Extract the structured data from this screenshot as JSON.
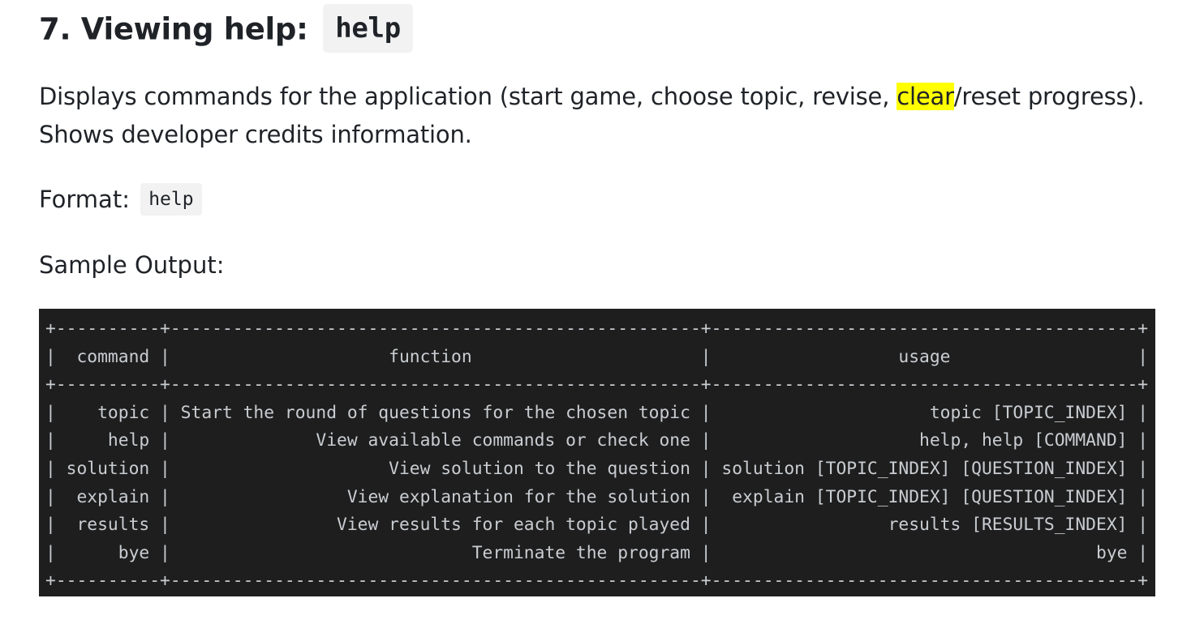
{
  "section": {
    "title_text": "7. Viewing help:",
    "title_code": "help",
    "description_before_highlight": "Displays commands for the application (start game, choose topic, revise, ",
    "description_highlight": "clear",
    "description_after_highlight": "/reset progress). Shows developer credits information.",
    "highlight_color": "#ffff00",
    "format_label": "Format:",
    "format_code": "help",
    "sample_output_label": "Sample Output:"
  },
  "terminal": {
    "background": "#1e1e1e",
    "headers": [
      "command",
      "function",
      "usage"
    ],
    "rows": [
      {
        "command": "topic",
        "function": "Start the round of questions for the chosen topic",
        "usage": "topic [TOPIC_INDEX]"
      },
      {
        "command": "help",
        "function": "View available commands or check one",
        "usage": "help, help [COMMAND]"
      },
      {
        "command": "solution",
        "function": "View solution to the question",
        "usage": "solution [TOPIC_INDEX] [QUESTION_INDEX]"
      },
      {
        "command": "explain",
        "function": "View explanation for the solution",
        "usage": "explain [TOPIC_INDEX] [QUESTION_INDEX]"
      },
      {
        "command": "results",
        "function": "View results for each topic played",
        "usage": "results [RESULTS_INDEX]"
      },
      {
        "command": "bye",
        "function": "Terminate the program",
        "usage": "bye"
      }
    ],
    "lines": [
      "+----------+---------------------------------------------------+-----------------------------------------+",
      "|  command |                     function                      |                  usage                  |",
      "+----------+---------------------------------------------------+-----------------------------------------+",
      "|    topic | Start the round of questions for the chosen topic |                     topic [TOPIC_INDEX] |",
      "|     help |              View available commands or check one |                    help, help [COMMAND] |",
      "| solution |                     View solution to the question | solution [TOPIC_INDEX] [QUESTION_INDEX] |",
      "|  explain |                 View explanation for the solution |  explain [TOPIC_INDEX] [QUESTION_INDEX] |",
      "|  results |                View results for each topic played |                 results [RESULTS_INDEX] |",
      "|      bye |                             Terminate the program |                                     bye |",
      "+----------+---------------------------------------------------+-----------------------------------------+"
    ]
  }
}
